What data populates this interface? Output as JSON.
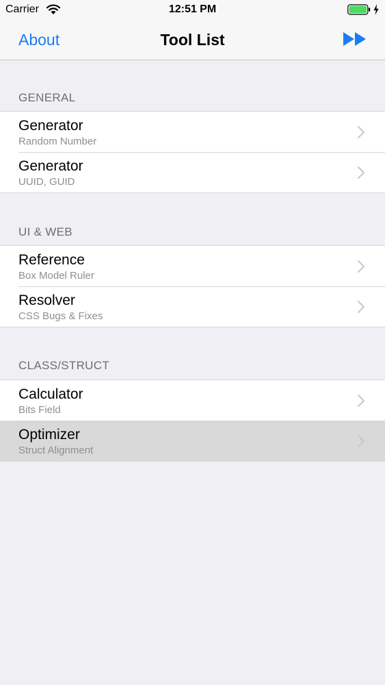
{
  "status_bar": {
    "carrier": "Carrier",
    "time": "12:51 PM",
    "wifi_icon": "wifi-icon",
    "battery_icon": "battery-icon",
    "charging_icon": "bolt-icon",
    "battery_color": "#4cd964"
  },
  "nav": {
    "left_label": "About",
    "title": "Tool List",
    "right_icon": "fast-forward-icon",
    "tint": "#1a7cf5"
  },
  "sections": [
    {
      "header": "GENERAL",
      "items": [
        {
          "title": "Generator",
          "subtitle": "Random Number"
        },
        {
          "title": "Generator",
          "subtitle": "UUID, GUID"
        }
      ]
    },
    {
      "header": "UI & WEB",
      "items": [
        {
          "title": "Reference",
          "subtitle": "Box Model Ruler"
        },
        {
          "title": "Resolver",
          "subtitle": "CSS Bugs & Fixes"
        }
      ]
    },
    {
      "header": "CLASS/STRUCT",
      "items": [
        {
          "title": "Calculator",
          "subtitle": "Bits Field"
        },
        {
          "title": "Optimizer",
          "subtitle": "Struct Alignment",
          "selected": true
        }
      ]
    }
  ]
}
